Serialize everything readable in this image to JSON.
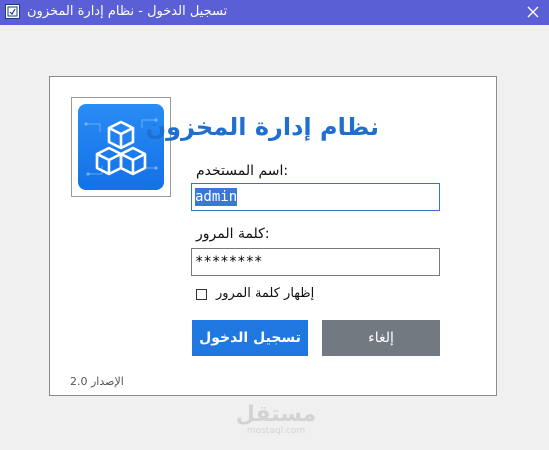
{
  "window": {
    "title": "تسجيل الدخول - نظام إدارة المخزون",
    "app_icon": "app-icon",
    "close_icon": "close-icon"
  },
  "login": {
    "logo_icon": "cubes-icon",
    "heading": "نظام إدارة المخزون",
    "username_label": "اسم المستخدم:",
    "username_value": "admin",
    "password_label": "كلمة المرور:",
    "password_value": "********",
    "show_password_label": "إظهار كلمة المرور",
    "show_password_checked": false,
    "login_button": "تسجيل الدخول",
    "cancel_button": "إلغاء",
    "version": "الإصدار 2.0"
  },
  "watermark": {
    "main": "مستقل",
    "sub": "mostaql.com"
  },
  "colors": {
    "titlebar": "#5b5fd6",
    "heading": "#1f6fd1",
    "login_button": "#1f78e0",
    "cancel_button": "#727980"
  }
}
